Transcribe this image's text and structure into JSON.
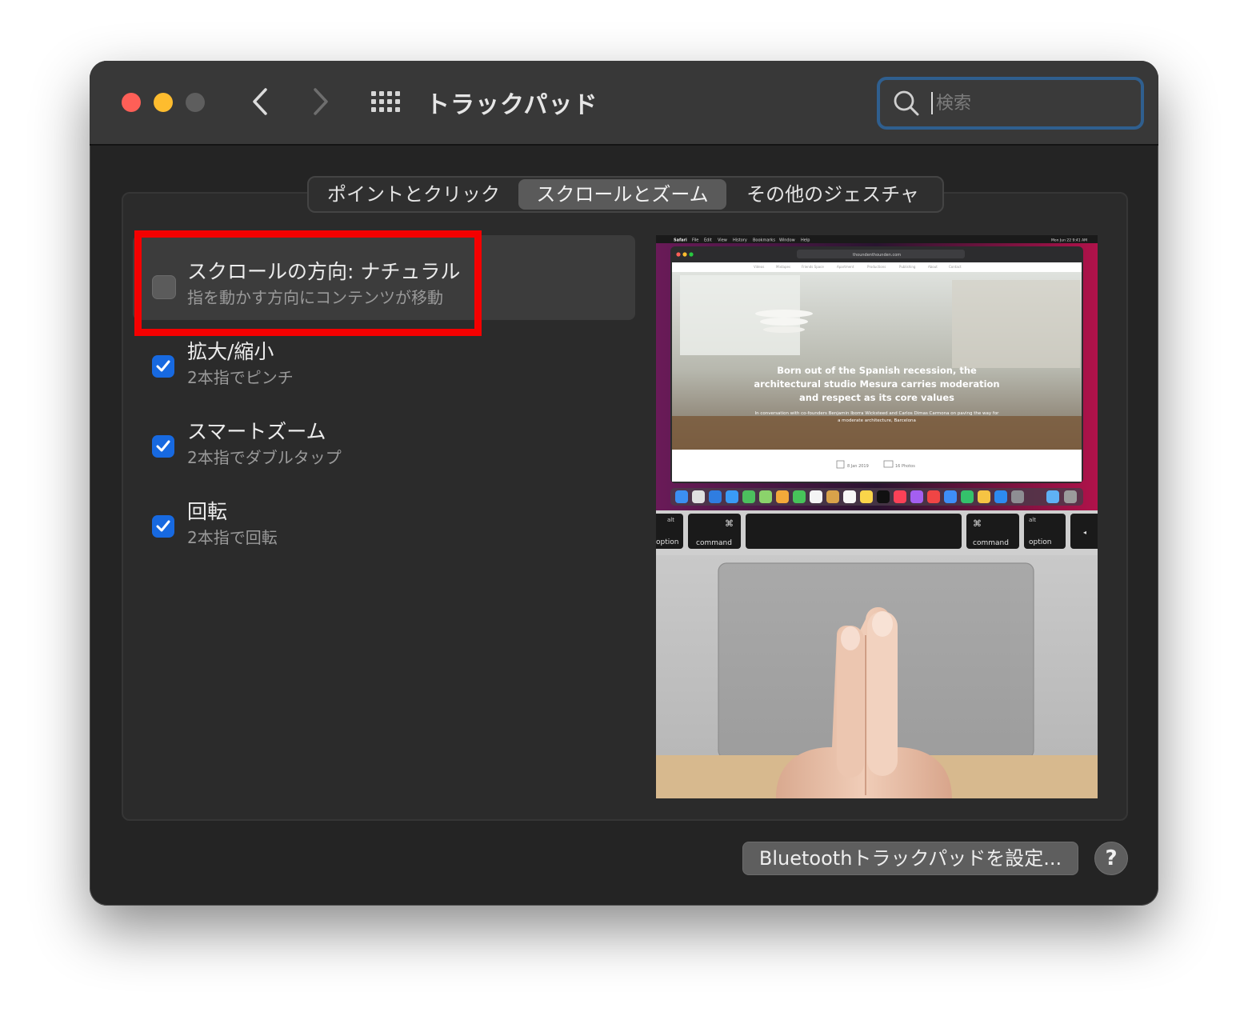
{
  "window": {
    "title": "トラックパッド",
    "search_placeholder": "検索"
  },
  "tabs": [
    {
      "label": "ポイントとクリック",
      "selected": false
    },
    {
      "label": "スクロールとズーム",
      "selected": true
    },
    {
      "label": "その他のジェスチャ",
      "selected": false
    }
  ],
  "options": [
    {
      "title": "スクロールの方向: ナチュラル",
      "subtitle": "指を動かす方向にコンテンツが移動",
      "checked": false
    },
    {
      "title": "拡大/縮小",
      "subtitle": "2本指でピンチ",
      "checked": true
    },
    {
      "title": "スマートズーム",
      "subtitle": "2本指でダブルタップ",
      "checked": true
    },
    {
      "title": "回転",
      "subtitle": "2本指で回転",
      "checked": true
    }
  ],
  "preview": {
    "headline_lines": [
      "Born out of the Spanish recession, the",
      "architectural studio Mesura carries moderation",
      "and respect as its core values"
    ],
    "byline_lines": [
      "In conversation with co-founders Benjamin Iborra Wicksteed and Carlos Dimas Carmona on paving the way for",
      "a moderate architecture, Barcelona"
    ],
    "date": "8 Jan 2019",
    "photos": "16 Photos",
    "menubar_items": [
      "Safari",
      "File",
      "Edit",
      "View",
      "History",
      "Bookmarks",
      "Window",
      "Help"
    ],
    "menubar_clock": "Mon Jun 22  9:41 AM",
    "url": "thoundenthounden.com",
    "site_nav": [
      "Videos",
      "Mixtapes",
      "Friends Space",
      "Apartment",
      "Productions",
      "Publishing",
      "About",
      "Contact"
    ],
    "keys": {
      "left_option": "option",
      "left_alt": "alt",
      "left_command": "command",
      "command_symbol": "⌘",
      "right_command": "command",
      "right_option": "option",
      "right_alt": "alt",
      "arrow": "◂"
    }
  },
  "buttons": {
    "bluetooth": "Bluetoothトラックパッドを設定...",
    "help": "?"
  },
  "colors": {
    "accent": "#1769e0",
    "highlight": "#f40000",
    "window_bg": "#242424"
  }
}
